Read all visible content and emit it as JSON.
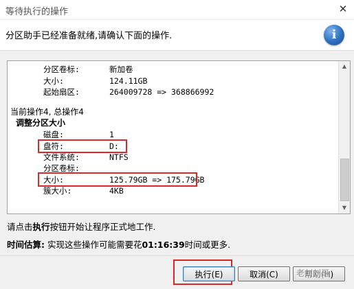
{
  "window": {
    "title": "等待执行的操作",
    "close_icon": "close-icon"
  },
  "header": {
    "message": "分区助手已经准备就绪,请确认下面的操作.",
    "icon": "info-icon"
  },
  "operations": {
    "prev_op": {
      "rows": [
        {
          "label": "分区卷标:",
          "value": "新加卷"
        },
        {
          "label": "大小:",
          "value": "124.11GB"
        },
        {
          "label": "起始扇区:",
          "value": "264009728 => 368866992"
        }
      ]
    },
    "current_status": "当前操作4, 总操作4",
    "op_title": "调整分区大小",
    "rows": [
      {
        "label": "磁盘:",
        "value": "1"
      },
      {
        "label": "盘符:",
        "value": "D:"
      },
      {
        "label": "文件系统:",
        "value": "NTFS"
      },
      {
        "label": "分区卷标:",
        "value": ""
      },
      {
        "label": "大小:",
        "value": "125.79GB => 175.79GB"
      },
      {
        "label": "簇大小:",
        "value": "4KB"
      }
    ]
  },
  "hint": {
    "prefix": "请点击",
    "bold": "执行",
    "suffix": "按钮开始让程序正式地工作."
  },
  "estimate": {
    "label": "时间估算:",
    "text": " 实现这些操作可能需要花",
    "time": "01:16:39",
    "suffix": "时间或更多."
  },
  "buttons": {
    "execute": "执行(E)",
    "cancel": "取消(C)",
    "help": "帮助(H)"
  },
  "watermark": "老刘刘哥",
  "colors": {
    "highlight": "#d9272c",
    "info_blue": "#2d6fbf"
  }
}
